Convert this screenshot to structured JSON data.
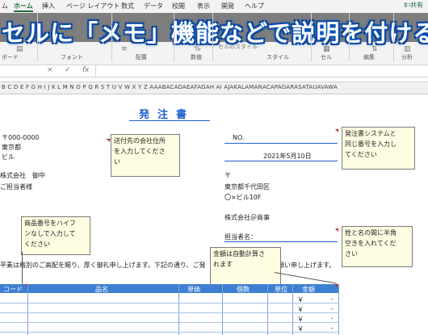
{
  "ribbon": {
    "tabs": [
      "ム",
      "ホーム",
      "挿入",
      "ページ レイアウト",
      "数式",
      "データ",
      "校閲",
      "表示",
      "開発",
      "ヘルプ"
    ],
    "share_label": "共有",
    "groups": [
      "ボード",
      "フォント",
      "配置",
      "数値",
      "スタイル",
      "セル",
      "編集",
      "分析"
    ],
    "group_icons": [
      "セルのスタイル"
    ]
  },
  "banner": {
    "text": "セルに「メモ」機能などで説明を付ける"
  },
  "formula_bar": {
    "fx": "fx",
    "cancel": "×",
    "enter": "✓"
  },
  "column_headers": "B C D E F G H I J K L M N O P Q R S T U V W X Y Z AAABACADAEAFAGAH AI AJAKALAMANACAPAGARASATAUAVAWA",
  "sheet": {
    "title": "発注書",
    "left_block": [
      "〒000-0000",
      "東京都",
      "ビル"
    ],
    "company_to": "株式会社　御中",
    "attn_to": "ご担当者様",
    "no_label": "NO.",
    "date": "2021年5月10日",
    "right_block": [
      "〒",
      "東京都千代田区",
      "〇×ビル10F"
    ],
    "company_from": "株式会社＠商事",
    "person_label": "担当者名：",
    "body_text_a": "平素は格別のご高配を賜り、厚く御礼申し上げます。下記の通り、ご発",
    "body_text_b": "願い申し上げます。"
  },
  "notes": {
    "address": "送付先の会社住所\nを入力してくださ\nい",
    "order_no": "発注書システムと\n同じ番号を入力し\nてください",
    "product_code": "商品番号をハイフ\nンなしで入力して\nください",
    "name": "姓と名の間に半角\n空きを入れてくだ\nさい",
    "amount": "金額は自動計算さ\nれます"
  },
  "table": {
    "headers": [
      "コード",
      "品名",
      "単価",
      "個数",
      "単位",
      "金額"
    ],
    "yen_symbol": "￥",
    "amount_placeholder": "-",
    "row_count": 4
  }
}
